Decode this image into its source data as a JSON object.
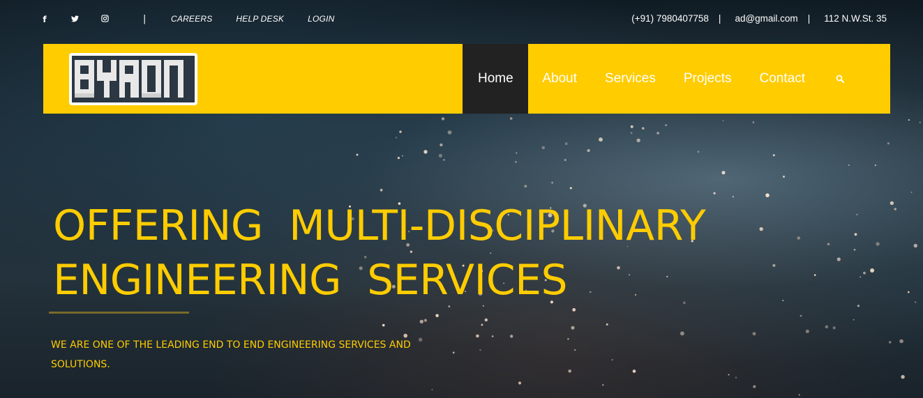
{
  "topbar": {
    "social": [
      {
        "icon": "facebook-icon",
        "glyph": "f"
      },
      {
        "icon": "twitter-icon",
        "glyph": "🐦"
      },
      {
        "icon": "instagram-icon",
        "glyph": "◎"
      }
    ],
    "pipe": "|",
    "links": [
      "CAREERS",
      "HELP DESK",
      "LOGIN"
    ],
    "phone": "(+91) 7980407758",
    "email": "ad@gmail.com",
    "address": "112 N.W.St. 35",
    "separator": "|"
  },
  "header": {
    "logo_text": "BYRON",
    "nav": [
      "Home",
      "About",
      "Services",
      "Projects",
      "Contact"
    ],
    "active": "Home",
    "search_icon": "search-icon"
  },
  "hero": {
    "title_line1": "OFFERING  MULTI-DISCIPLINARY",
    "title_line2": "ENGINEERING  SERVICES",
    "subtitle": "WE ARE ONE OF THE LEADING END TO END ENGINEERING SERVICES AND SOLUTIONS."
  },
  "colors": {
    "accent": "#ffcc00",
    "nav_active_bg": "#222222",
    "text": "#ffffff"
  }
}
